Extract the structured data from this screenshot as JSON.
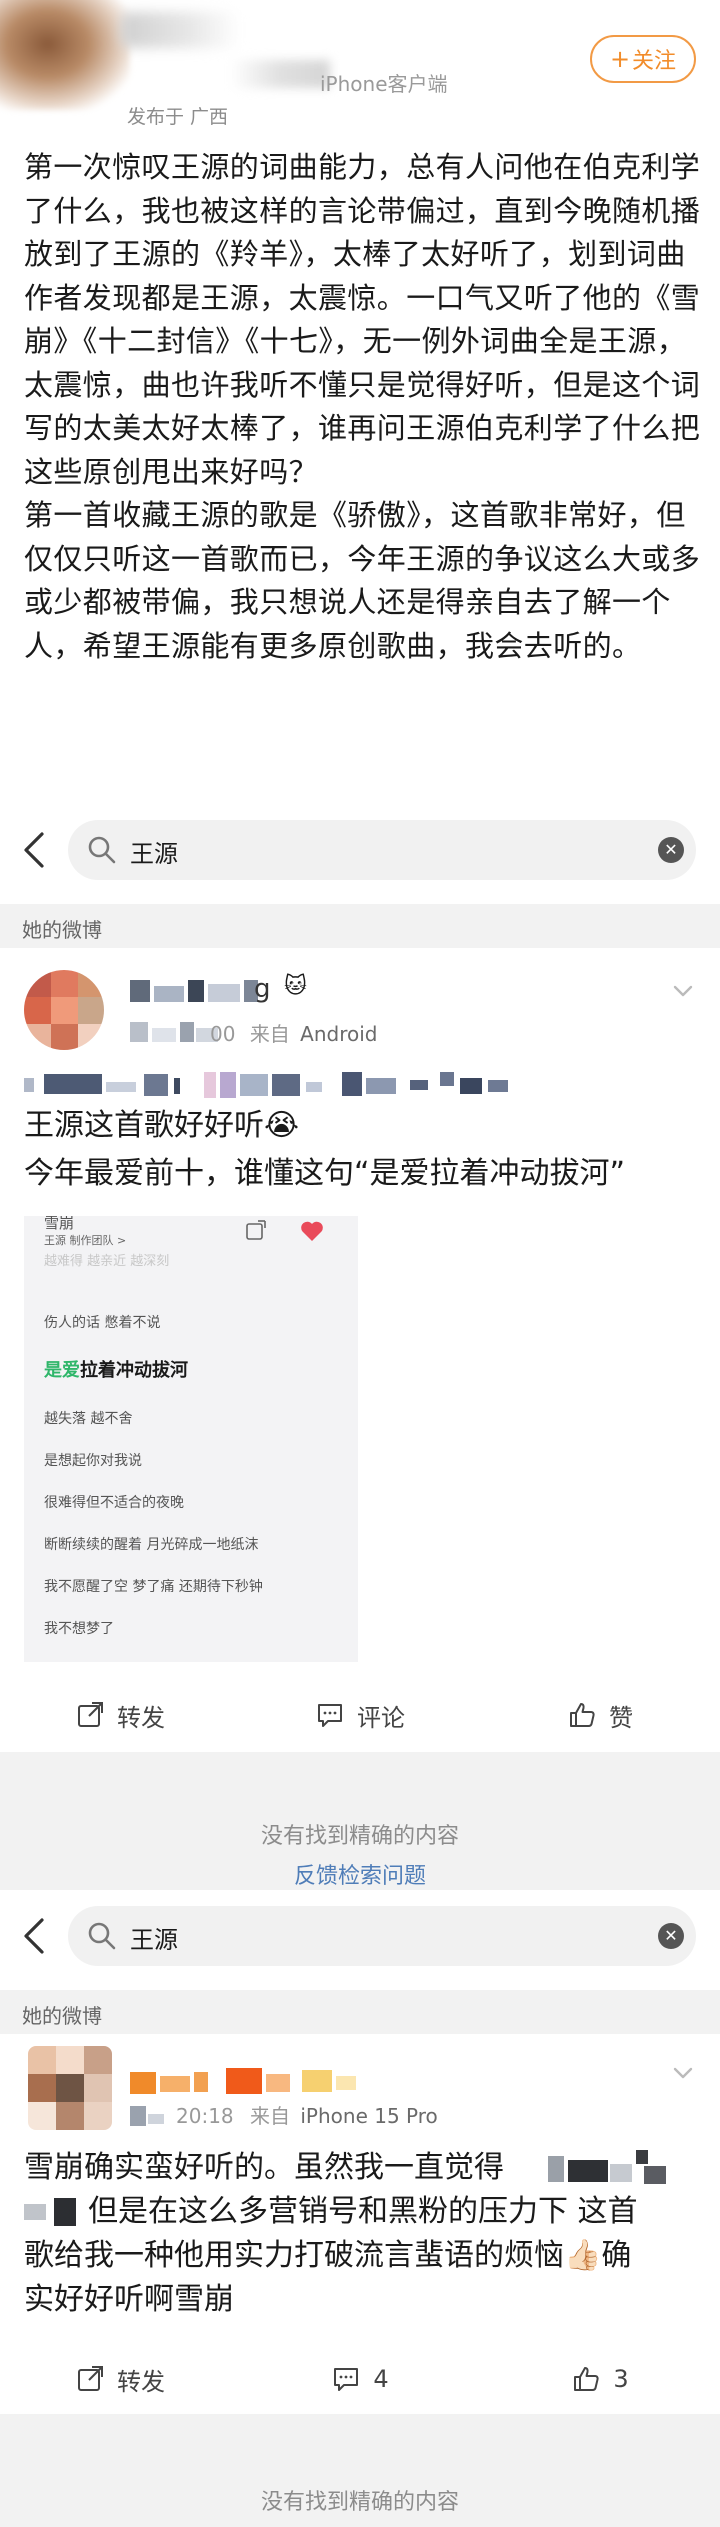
{
  "top_post": {
    "client": "iPhone客户端",
    "location": "发布于 广西",
    "follow_label": "关注",
    "paragraphs": [
      "第一次惊叹王源的词曲能力，总有人问他在伯克利学了什么，我也被这样的言论带偏过，直到今晚随机播放到了王源的《羚羊》，太棒了太好听了，划到词曲作者发现都是王源，太震惊。一口气又听了他的《雪崩》《十二封信》《十七》，无一例外词曲全是王源，太震惊，曲也许我听不懂只是觉得好听，但是这个词写的太美太好太棒了，谁再问王源伯克利学了什么把这些原创甩出来好吗？",
      "第一首收藏王源的歌是《骄傲》，这首歌非常好，但仅仅只听这一首歌而已，今年王源的争议这么大或多或少都被带偏，我只想说人还是得亲自去了解一个人，希望王源能有更多原创歌曲，我会去听的。"
    ]
  },
  "search_1": {
    "query": "王源",
    "section_label": "她的微博"
  },
  "card_1": {
    "name_tail": "g",
    "meta_tail": "00",
    "source_prefix": "来自",
    "source": "Android",
    "lines": [
      "王源这首歌好好听😭",
      "今年最爱前十，谁懂这句“是爱拉着冲动拔河”"
    ],
    "lyric_image": {
      "title": "雪崩",
      "meta": "王源   制作团队 >",
      "faded": "越难得 越亲近 越深刻",
      "highlight_accent": "是爱",
      "highlight_rest": "拉着冲动拔河",
      "lines": [
        "伤人的话 憋着不说",
        "越失落 越不舍",
        "是想起你对我说",
        "很难得但不适合的夜晚",
        "断断续续的醒着 月光碎成一地纸沫",
        "我不愿醒了空 梦了痛 还期待下秒钟",
        "我不想梦了"
      ]
    },
    "actions": {
      "repost": "转发",
      "comment": "评论",
      "like": "赞"
    }
  },
  "no_result_1": {
    "text": "没有找到精确的内容",
    "feedback": "反馈检索问题"
  },
  "search_2": {
    "query": "王源",
    "section_label": "她的微博"
  },
  "card_2": {
    "time": "20:18",
    "source_prefix": "来自",
    "source": "iPhone 15 Pro",
    "lines": [
      "雪崩确实蛮好听的。虽然我一直觉得",
      "但是在这么多营销号和黑粉的压力下 这首",
      "歌给我一种他用实力打破流言蜚语的烦恼👍🏻确",
      "实好好听啊雪崩"
    ],
    "actions": {
      "repost": "转发",
      "comment": "4",
      "like": "3"
    }
  },
  "no_result_2": {
    "text": "没有找到精确的内容"
  },
  "colors": {
    "follow_orange": "#f28c2a",
    "feedback_blue": "#4f7db8",
    "lyric_green": "#2fb66a"
  }
}
